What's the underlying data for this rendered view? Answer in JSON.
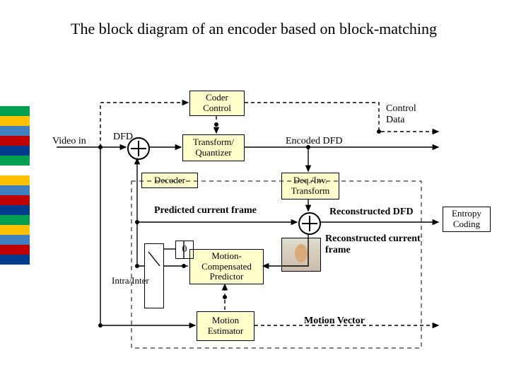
{
  "title": "The block diagram of an encoder based on block-matching",
  "blocks": {
    "coder_control": "Coder\nControl",
    "transform_quantizer": "Transform/\nQuantizer",
    "decoder_badge": "Decoder",
    "deq_inv_transform": "Deq./Inv.\nTransform",
    "motion_comp_predictor": "Motion-\nCompensated\nPredictor",
    "motion_estimator": "Motion\nEstimator",
    "entropy_coding": "Entropy\nCoding"
  },
  "labels": {
    "video_in": "Video in",
    "dfd": "DFD",
    "encoded_dfd": "Encoded DFD",
    "control_data": "Control\nData",
    "predicted_current_frame": "Predicted current frame",
    "reconstructed_dfd": "Reconstructed DFD",
    "reconstructed_current_frame": "Reconstructed current\nframe",
    "motion_vector": "Motion Vector",
    "zero": "0",
    "intra_inter": "Intra/Inter"
  }
}
